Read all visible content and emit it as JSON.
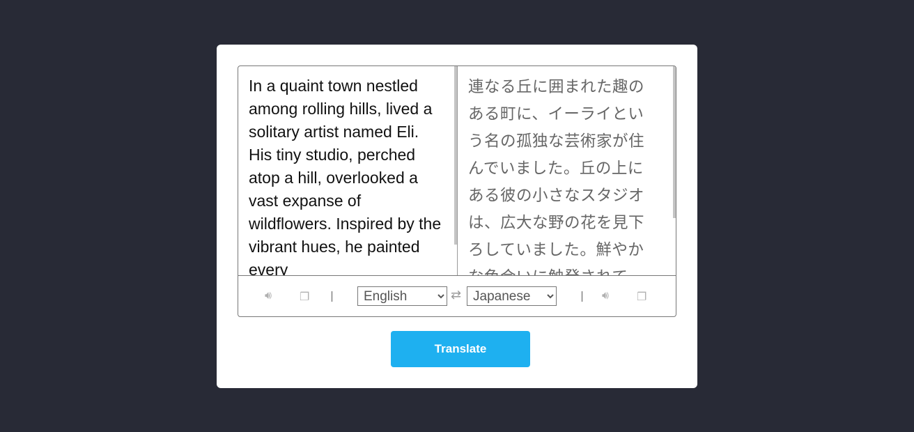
{
  "source": {
    "text": "In a quaint town nestled among rolling hills, lived a solitary artist named Eli. His tiny studio, perched atop a hill, overlooked a vast expanse of wildflowers. Inspired by the vibrant hues, he painted every"
  },
  "target": {
    "text": "連なる丘に囲まれた趣のある町に、イーライという名の孤独な芸術家が住んでいました。丘の上にある彼の小さなスタジオは、広大な野の花を見下ろしていました。鮮やかな色合いに触発されて"
  },
  "toolbar": {
    "source_language": "English",
    "target_language": "Japanese",
    "icons": [
      "speaker-icon",
      "copy-icon",
      "swap-icon",
      "speaker-icon",
      "copy-icon"
    ]
  },
  "translate_label": "Translate",
  "colors": {
    "accent": "#1eb0f0",
    "background": "#282a36"
  }
}
